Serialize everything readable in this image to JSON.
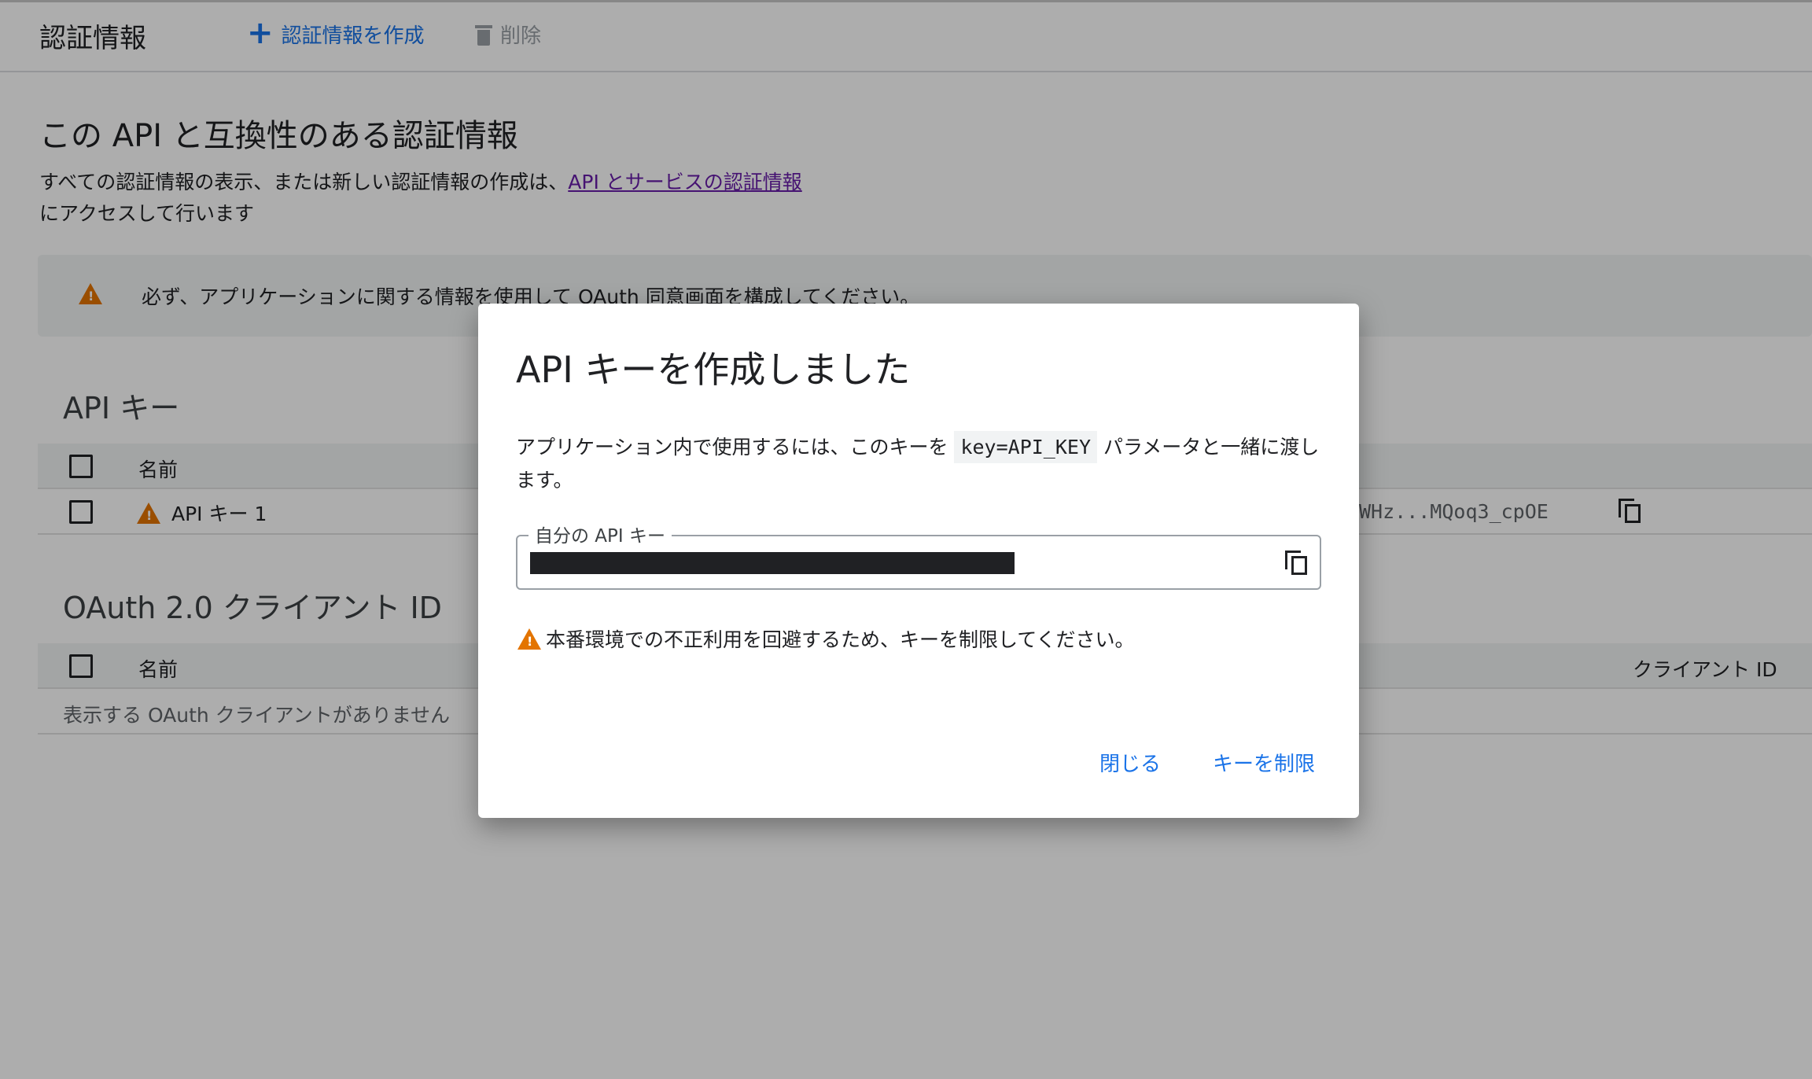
{
  "header": {
    "title": "認証情報",
    "create_label": "認証情報を作成",
    "delete_label": "削除"
  },
  "main": {
    "heading": "この API と互換性のある認証情報",
    "intro_prefix": "すべての認証情報の表示、または新しい認証情報の作成は、",
    "intro_link": "API とサービスの認証情報",
    "intro_suffix": "にアクセスして行います",
    "consent_warning": "必ず、アプリケーションに関する情報を使用して OAuth 同意画面を構成してください。"
  },
  "api_keys": {
    "heading": "API キー",
    "col_name": "名前",
    "rows": [
      {
        "name": "API キー 1",
        "key_preview": "WHz...MQoq3_cpOE"
      }
    ]
  },
  "oauth": {
    "heading": "OAuth 2.0 クライアント ID",
    "col_name": "名前",
    "col_client_id": "クライアント ID",
    "empty_message": "表示する OAuth クライアントがありません"
  },
  "dialog": {
    "title": "API キーを作成しました",
    "desc_prefix": "アプリケーション内で使用するには、このキーを ",
    "desc_code": "key=API_KEY",
    "desc_suffix": " パラメータと一緒に渡します。",
    "field_label": "自分の API キー",
    "warning": "本番環境での不正利用を回避するため、キーを制限してください。",
    "close_label": "閉じる",
    "restrict_label": "キーを制限"
  },
  "colors": {
    "accent": "#1a73e8",
    "warning": "#e37400",
    "link_visited": "#681da8"
  }
}
